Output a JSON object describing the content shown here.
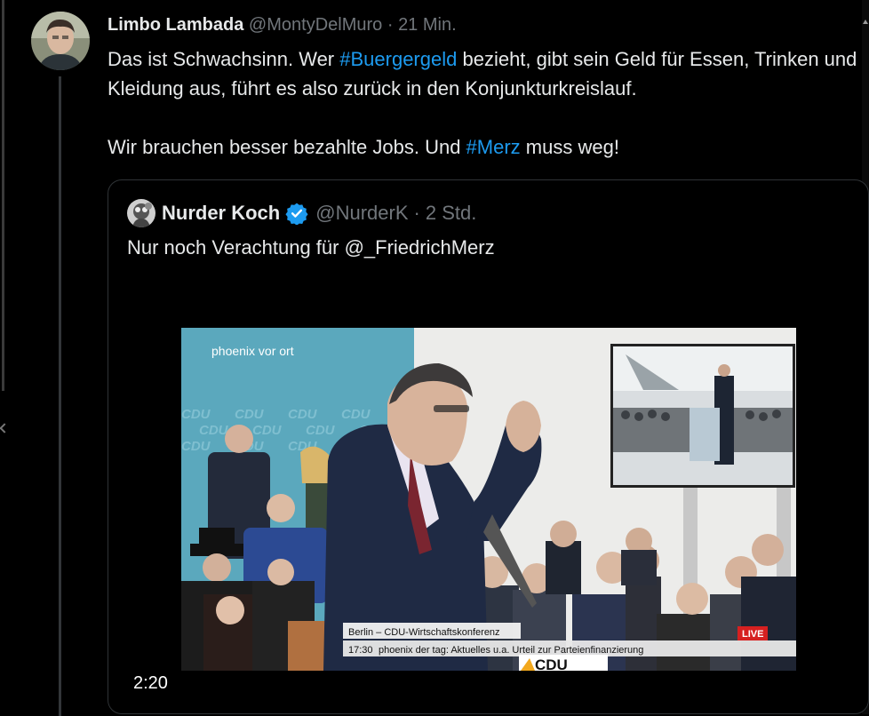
{
  "tweet": {
    "display_name": "Limbo Lambada",
    "handle": "@MontyDelMuro",
    "separator": "·",
    "time": "21 Min.",
    "text_part1": "Das ist Schwachsinn. Wer ",
    "hashtag1": "#Buergergeld",
    "text_part2": " bezieht, gibt sein Geld für Essen, Trinken und Kleidung aus, führt es also zurück in den Konjunkturkreislauf.",
    "text_part3": "Wir brauchen besser bezahlte Jobs. Und ",
    "hashtag2": "#Merz",
    "text_part4": " muss weg!"
  },
  "quote": {
    "display_name": "Nurder Koch",
    "handle": "@NurderK",
    "separator": "·",
    "time": "2 Std.",
    "text": "Nur noch Verachtung für @_FriedrichMerz",
    "video": {
      "duration": "2:20",
      "channel_logo": "phoenix vor ort",
      "backdrop_text": "CDU",
      "lower_third_title": "Berlin – CDU-Wirtschaftskonferenz",
      "lower_third_time": "17:30",
      "lower_third_text": "phoenix der tag: Aktuelles u.a. Urteil zur Parteienfinanzierung",
      "live_badge": "LIVE",
      "podium_text": "CDU"
    }
  },
  "colors": {
    "link": "#1d9bf0",
    "muted": "#71767b",
    "text": "#e7e9ea",
    "verified": "#1d9bf0"
  }
}
